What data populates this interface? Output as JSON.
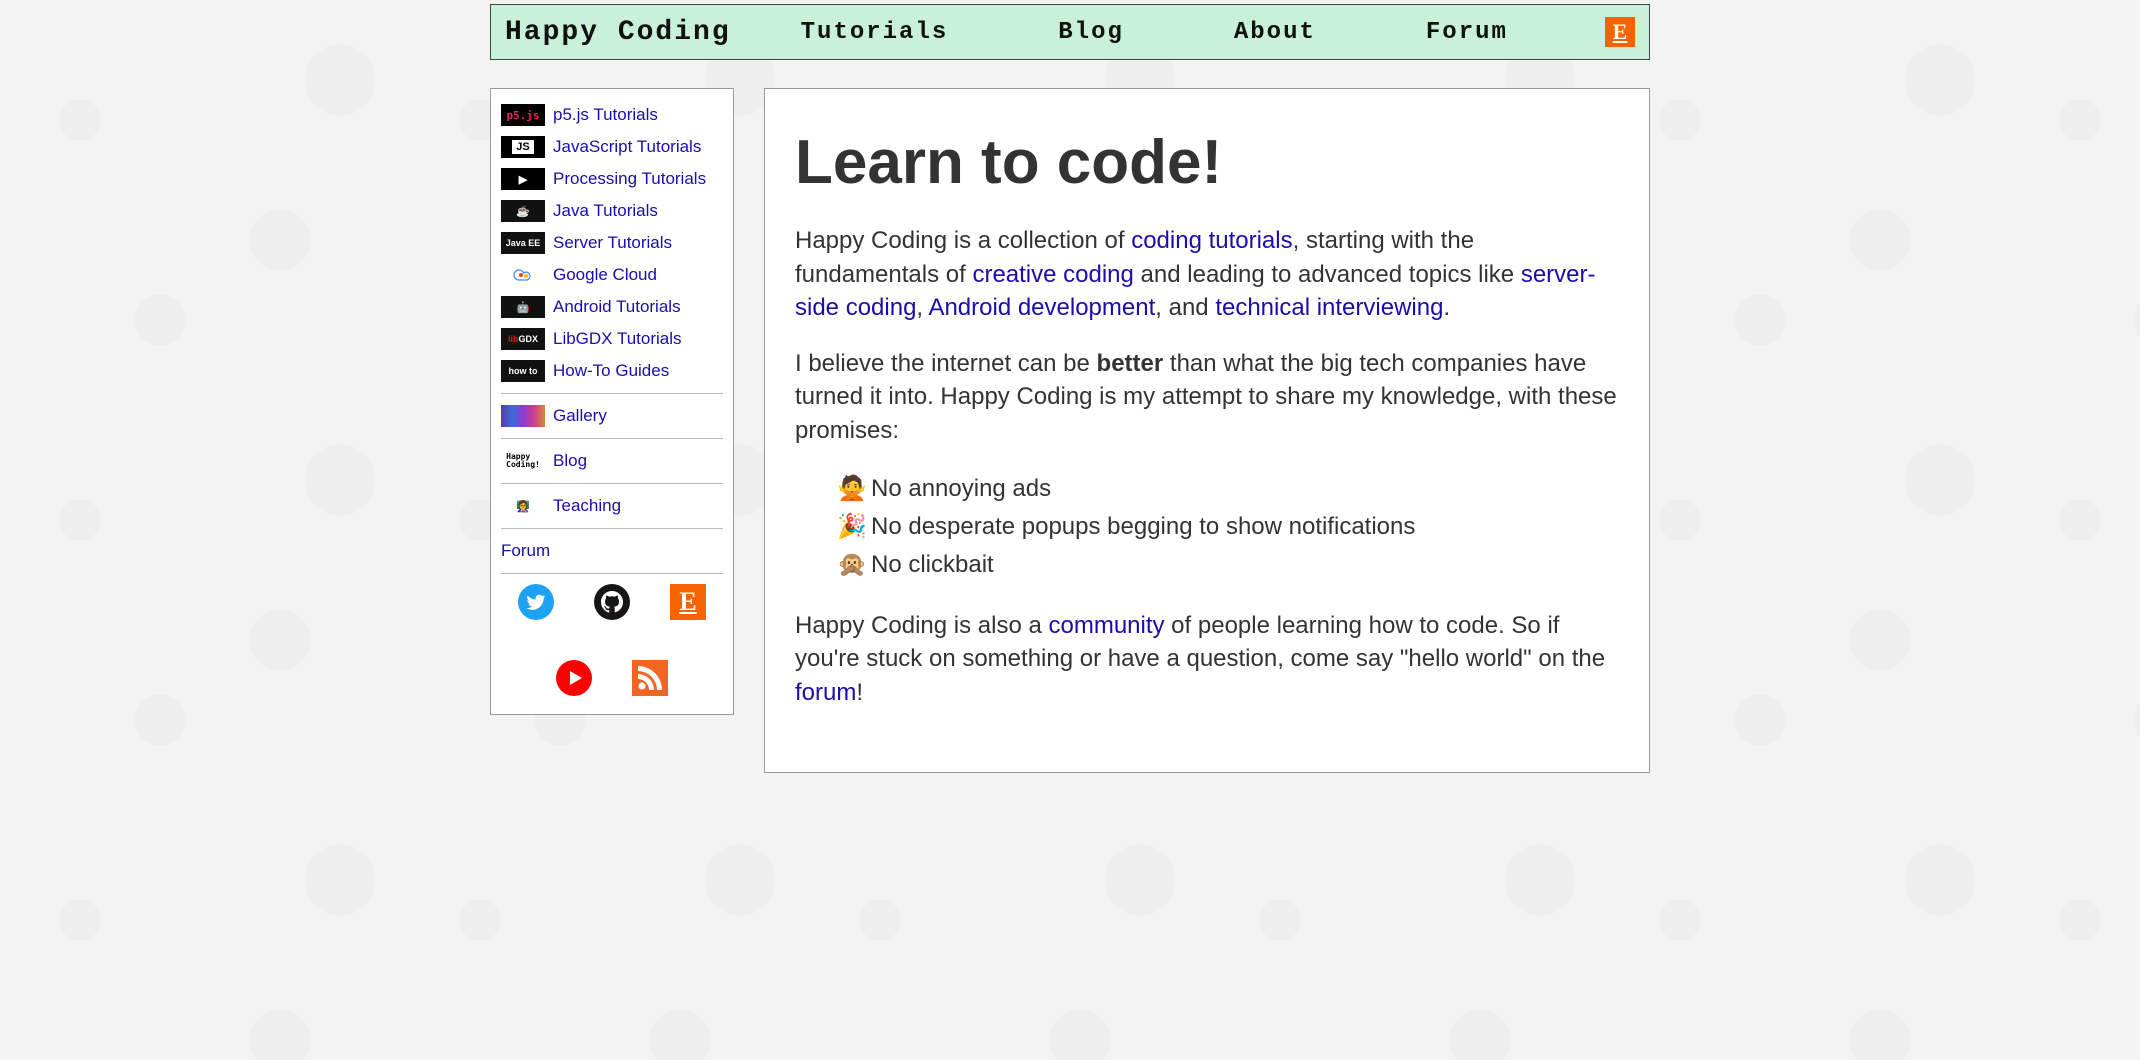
{
  "nav": {
    "brand": "Happy Coding",
    "items": [
      "Tutorials",
      "Blog",
      "About",
      "Forum"
    ]
  },
  "sidebar": {
    "groups": [
      [
        {
          "icon": "p5js",
          "label": "p5.js Tutorials"
        },
        {
          "icon": "js",
          "label": "JavaScript Tutorials"
        },
        {
          "icon": "processing",
          "label": "Processing Tutorials"
        },
        {
          "icon": "java",
          "label": "Java Tutorials"
        },
        {
          "icon": "javaee",
          "label": "Server Tutorials"
        },
        {
          "icon": "gcloud",
          "label": "Google Cloud"
        },
        {
          "icon": "android",
          "label": "Android Tutorials"
        },
        {
          "icon": "libgdx",
          "label": "LibGDX Tutorials"
        },
        {
          "icon": "howto",
          "label": "How-To Guides"
        }
      ],
      [
        {
          "icon": "gallery",
          "label": "Gallery"
        }
      ],
      [
        {
          "icon": "blogicon",
          "label": "Blog"
        }
      ],
      [
        {
          "icon": "teaching",
          "label": "Teaching"
        }
      ]
    ],
    "forum_label": "Forum",
    "social": [
      "twitter",
      "github",
      "etsy",
      "youtube",
      "rss"
    ]
  },
  "main": {
    "heading": "Learn to code!",
    "p1_pre": "Happy Coding is a collection of ",
    "p1_link1": "coding tutorials",
    "p1_mid1": ", starting with the fundamentals of ",
    "p1_link2": "creative coding",
    "p1_mid2": " and leading to advanced topics like ",
    "p1_link3": "server-side coding",
    "p1_sep1": ", ",
    "p1_link4": "Android development",
    "p1_sep2": ", and ",
    "p1_link5": "technical interviewing",
    "p1_end": ".",
    "p2_pre": "I believe the internet can be ",
    "p2_bold": "better",
    "p2_post": " than what the big tech companies have turned it into. Happy Coding is my attempt to share my knowledge, with these promises:",
    "bullets": [
      {
        "emoji": "🙅",
        "text": "No annoying ads"
      },
      {
        "emoji": "🎉",
        "text": "No desperate popups begging to show notifications"
      },
      {
        "emoji": "🙊",
        "text": "No clickbait"
      }
    ],
    "p3_pre": "Happy Coding is also a ",
    "p3_link1": "community",
    "p3_mid": " of people learning how to code. So if you're stuck on something or have a question, come say \"hello world\" on the ",
    "p3_link2": "forum",
    "p3_end": "!"
  }
}
